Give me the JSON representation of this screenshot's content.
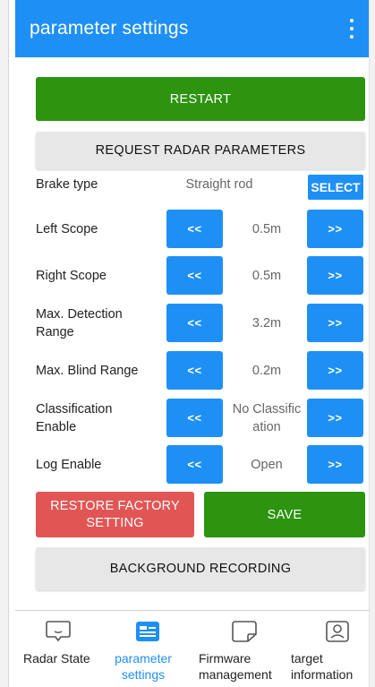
{
  "appbar": {
    "title": "parameter settings",
    "menu_icon": "more-vert-icon"
  },
  "actions": {
    "restart": "RESTART",
    "request": "REQUEST RADAR PARAMETERS",
    "restore": "RESTORE FACTORY SETTING",
    "save": "SAVE",
    "background": "BACKGROUND RECORDING"
  },
  "brake": {
    "label": "Brake type",
    "value": "Straight rod",
    "select": "SELECT"
  },
  "params": [
    {
      "label": "Left Scope",
      "value": "0.5m",
      "dec": "<<",
      "inc": ">>"
    },
    {
      "label": "Right Scope",
      "value": "0.5m",
      "dec": "<<",
      "inc": ">>"
    },
    {
      "label": "Max. Detection Range",
      "value": "3.2m",
      "dec": "<<",
      "inc": ">>"
    },
    {
      "label": "Max. Blind Range",
      "value": "0.2m",
      "dec": "<<",
      "inc": ">>"
    },
    {
      "label": "Classification Enable",
      "value": "No Classification",
      "dec": "<<",
      "inc": ">>"
    },
    {
      "label": "Log Enable",
      "value": "Open",
      "dec": "<<",
      "inc": ">>"
    }
  ],
  "nav": [
    {
      "label": "Radar State",
      "icon": "chat-bubble-icon",
      "active": false
    },
    {
      "label": "parameter settings",
      "icon": "settings-card-icon",
      "active": true
    },
    {
      "label": "Firmware management",
      "icon": "firmware-icon",
      "active": false
    },
    {
      "label": "target information",
      "icon": "person-card-icon",
      "active": false
    }
  ],
  "colors": {
    "primary": "#1e90f5",
    "green": "#2c940e",
    "red": "#e25555"
  }
}
